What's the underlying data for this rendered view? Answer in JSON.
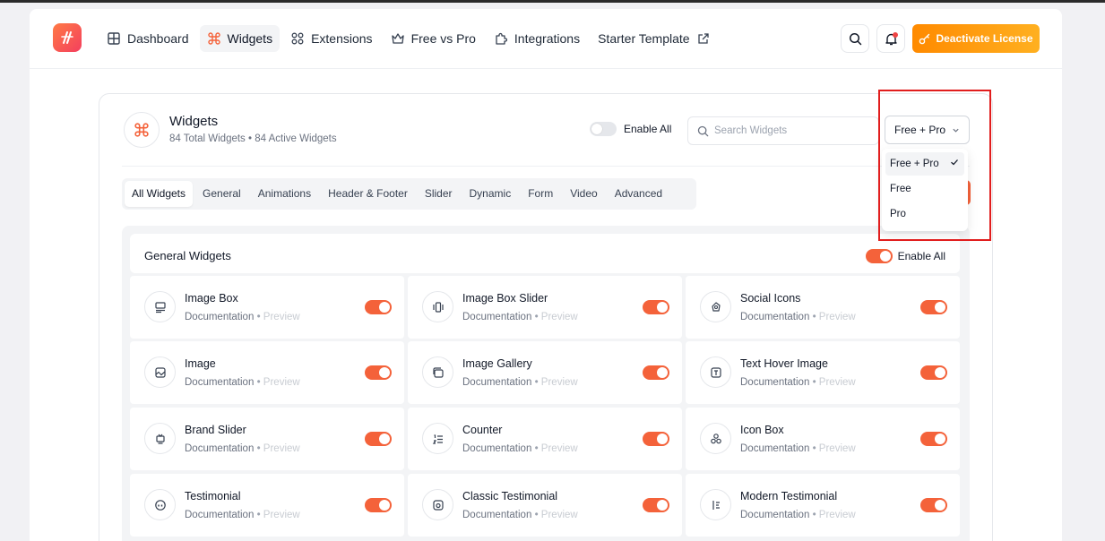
{
  "nav": {
    "items": [
      {
        "label": "Dashboard",
        "icon": "grid-icon",
        "active": false
      },
      {
        "label": "Widgets",
        "icon": "command-icon",
        "active": true
      },
      {
        "label": "Extensions",
        "icon": "blocks-icon",
        "active": false
      },
      {
        "label": "Free vs Pro",
        "icon": "crown-icon",
        "active": false
      },
      {
        "label": "Integrations",
        "icon": "puzzle-icon",
        "active": false
      },
      {
        "label": "Starter Template",
        "icon": "external-link-icon",
        "active": false
      }
    ],
    "license_button": "Deactivate License"
  },
  "widgets_header": {
    "title": "Widgets",
    "subtitle": "84 Total Widgets • 84 Active Widgets",
    "enable_all_label": "Enable All",
    "enable_all_on": false,
    "search_placeholder": "Search Widgets",
    "filter_value": "Free + Pro"
  },
  "tabs": [
    "All Widgets",
    "General",
    "Animations",
    "Header & Footer",
    "Slider",
    "Dynamic",
    "Form",
    "Video",
    "Advanced"
  ],
  "filter_dropdown": {
    "options": [
      "Free + Pro",
      "Free",
      "Pro"
    ],
    "selected": "Free + Pro"
  },
  "group": {
    "title": "General Widgets",
    "enable_all_label": "Enable All",
    "enable_all_on": true
  },
  "card_links": {
    "doc": "Documentation",
    "sep": "•",
    "preview": "Preview"
  },
  "widgets": [
    {
      "name": "Image Box",
      "icon": "image-box-icon",
      "on": true
    },
    {
      "name": "Image Box Slider",
      "icon": "slider-icon",
      "on": true
    },
    {
      "name": "Social Icons",
      "icon": "social-icon",
      "on": true
    },
    {
      "name": "Image",
      "icon": "image-icon",
      "on": true
    },
    {
      "name": "Image Gallery",
      "icon": "gallery-icon",
      "on": true
    },
    {
      "name": "Text Hover Image",
      "icon": "text-hover-icon",
      "on": true
    },
    {
      "name": "Brand Slider",
      "icon": "brand-slider-icon",
      "on": true
    },
    {
      "name": "Counter",
      "icon": "counter-icon",
      "on": true
    },
    {
      "name": "Icon Box",
      "icon": "icon-box-icon",
      "on": true
    },
    {
      "name": "Testimonial",
      "icon": "quote-icon",
      "on": true
    },
    {
      "name": "Classic Testimonial",
      "icon": "classic-testimonial-icon",
      "on": true
    },
    {
      "name": "Modern Testimonial",
      "icon": "modern-testimonial-icon",
      "on": true
    }
  ],
  "colors": {
    "accent": "#f4623a",
    "license": "#ff9a10",
    "highlight": "#e11d1d"
  }
}
